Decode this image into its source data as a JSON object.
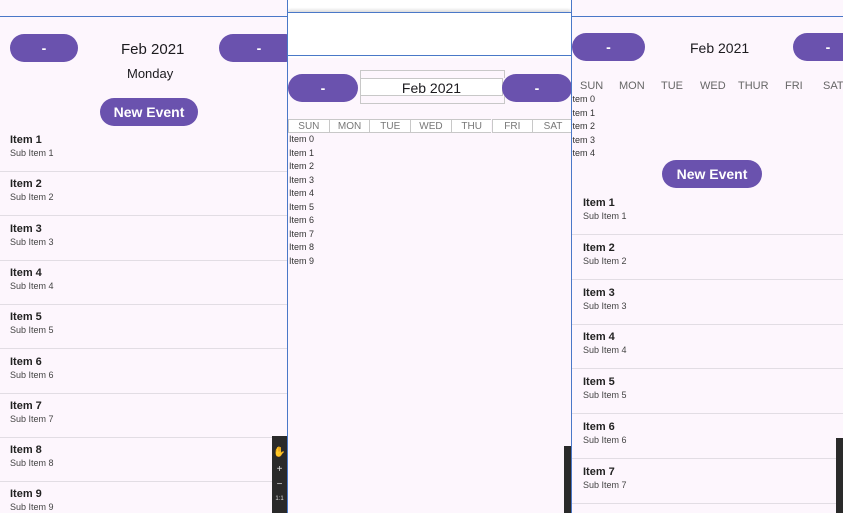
{
  "left": {
    "prev_label": "-",
    "next_label": "-",
    "month": "Feb 2021",
    "day": "Monday",
    "new_event": "New Event",
    "items": [
      {
        "title": "Item 1",
        "sub": "Sub Item 1"
      },
      {
        "title": "Item 2",
        "sub": "Sub Item 2"
      },
      {
        "title": "Item 3",
        "sub": "Sub Item 3"
      },
      {
        "title": "Item 4",
        "sub": "Sub Item 4"
      },
      {
        "title": "Item 5",
        "sub": "Sub Item 5"
      },
      {
        "title": "Item 6",
        "sub": "Sub Item 6"
      },
      {
        "title": "Item 7",
        "sub": "Sub Item 7"
      },
      {
        "title": "Item 8",
        "sub": "Sub Item 8"
      },
      {
        "title": "Item 9",
        "sub": "Sub Item 9"
      }
    ]
  },
  "middle": {
    "prev_label": "-",
    "next_label": "-",
    "month": "Feb 2021",
    "weekdays": [
      "SUN",
      "MON",
      "TUE",
      "WED",
      "THU",
      "FRI",
      "SAT"
    ],
    "items": [
      "Item 0",
      "Item 1",
      "Item 2",
      "Item 3",
      "Item 4",
      "Item 5",
      "Item 6",
      "Item 7",
      "Item 8",
      "Item 9"
    ]
  },
  "right": {
    "prev_label": "-",
    "next_label": "-",
    "month": "Feb 2021",
    "weekdays": [
      "SUN",
      "MON",
      "TUE",
      "WED",
      "THUR",
      "FRI",
      "SAT"
    ],
    "mini_items": [
      "Item 0",
      "Item 1",
      "Item 2",
      "Item 3",
      "Item 4"
    ],
    "new_event": "New Event",
    "items": [
      {
        "title": "Item 1",
        "sub": "Sub Item 1"
      },
      {
        "title": "Item 2",
        "sub": "Sub Item 2"
      },
      {
        "title": "Item 3",
        "sub": "Sub Item 3"
      },
      {
        "title": "Item 4",
        "sub": "Sub Item 4"
      },
      {
        "title": "Item 5",
        "sub": "Sub Item 5"
      },
      {
        "title": "Item 6",
        "sub": "Sub Item 6"
      },
      {
        "title": "Item 7",
        "sub": "Sub Item 7"
      }
    ]
  },
  "zoom": {
    "plus": "+",
    "minus": "−",
    "ratio": "1:1"
  },
  "colors": {
    "accent": "#6a52ae",
    "background": "#fdf6fd",
    "border": "#4a78c8"
  }
}
